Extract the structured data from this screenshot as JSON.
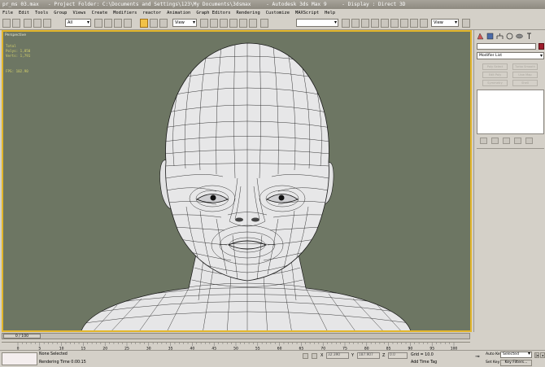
{
  "window": {
    "title": "pr_ms 03.max   - Project Folder: C:\\Documents and Settings\\123\\My Documents\\3dsmax     - Autodesk 3ds Max 9     - Display : Direct 3D"
  },
  "menu": {
    "items": [
      "File",
      "Edit",
      "Tools",
      "Group",
      "Views",
      "Create",
      "Modifiers",
      "reactor",
      "Animation",
      "Graph Editors",
      "Rendering",
      "Customize",
      "MAXScript",
      "Help"
    ]
  },
  "toolbar": {
    "selection_filter": "All",
    "reference_coord": "View",
    "named_selection": "",
    "view_dropdown": "View"
  },
  "viewport": {
    "label": "Perspective",
    "stats": {
      "heading": "Total",
      "polys": "Polys: 1,850",
      "verts": "Verts: 1,791"
    },
    "fps": "FPS:     102.90"
  },
  "command_panel": {
    "modifier_list": "Modifier List",
    "buttons": [
      "Poly Select",
      "Turbo Smooth",
      "Edit Poly",
      "Uvw Map",
      "Symmetry",
      "Shell"
    ],
    "object_color": "#9e1c2c"
  },
  "timeline": {
    "slider": "0 / 100",
    "ticks": [
      "0",
      "5",
      "10",
      "15",
      "20",
      "25",
      "30",
      "35",
      "40",
      "45",
      "50",
      "55",
      "60",
      "65",
      "70",
      "75",
      "80",
      "85",
      "90",
      "95",
      "100"
    ]
  },
  "status": {
    "selection": "None Selected",
    "render_time": "Rendering Time  0:00:15",
    "x_label": "X",
    "x_value": "32.390",
    "y_label": "Y",
    "y_value": "187.907",
    "z_label": "Z",
    "z_value": "0.0",
    "grid": "Grid = 10.0",
    "time_tag": "Add Time Tag"
  },
  "animation": {
    "auto_key": "Auto Key",
    "set_key": "Set Key",
    "selected": "Selected",
    "key_filters": "Key Filters..."
  },
  "colors": {
    "viewport_bg": "#6d7663",
    "viewport_border": "#e3b62b",
    "mesh_fill": "#e5e5e6",
    "mesh_wire": "#1a1a1a"
  }
}
